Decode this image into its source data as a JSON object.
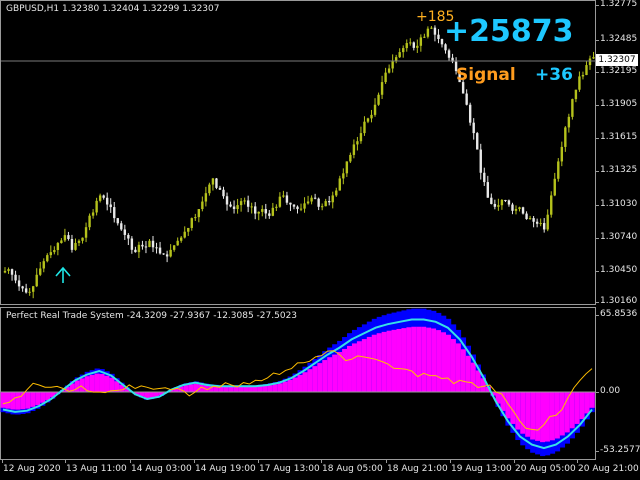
{
  "chart": {
    "symbol_label": "GBPUSD,H1  1.32380  1.32404  1.32299  1.32307",
    "current_price": "1.32307",
    "profit_big": "+25873",
    "profit_small": "+185",
    "signal_label": "Signal",
    "signal_value": "+36",
    "price_ticks": [
      "1.32775",
      "1.32485",
      "1.32195",
      "1.31905",
      "1.31615",
      "1.31325",
      "1.31030",
      "1.30740",
      "1.30450",
      "1.30160"
    ],
    "colors": {
      "bull_candle": "#b5c21c",
      "bear_candle": "#e8e8e8",
      "arrow": "#1ee6e6",
      "frame": "#9a9a9a"
    }
  },
  "indicator": {
    "label": "Perfect Real Trade System -24.3209 -27.9367 -12.3085 -27.5023",
    "ticks": [
      "65.8536",
      "0.00",
      "-53.2577"
    ],
    "colors": {
      "histogram_blue": "#0000ff",
      "histogram_magenta": "#ff00ff",
      "cyan_line": "#36e0e6",
      "yellow_line": "#ffbf00"
    }
  },
  "time_axis": [
    "12 Aug 2020",
    "13 Aug 11:00",
    "14 Aug 03:00",
    "14 Aug 19:00",
    "17 Aug 13:00",
    "18 Aug 05:00",
    "18 Aug 21:00",
    "19 Aug 13:00",
    "20 Aug 05:00",
    "20 Aug 21:00"
  ],
  "chart_data": [
    {
      "type": "candlestick",
      "title": "GBPUSD,H1",
      "ylim": [
        1.3016,
        1.3278
      ],
      "close": [
        1.3045,
        1.3035,
        1.3028,
        1.3025,
        1.304,
        1.3052,
        1.306,
        1.3068,
        1.3075,
        1.3062,
        1.307,
        1.3082,
        1.3095,
        1.311,
        1.3102,
        1.309,
        1.308,
        1.3072,
        1.306,
        1.3065,
        1.307,
        1.3064,
        1.3058,
        1.3062,
        1.307,
        1.3078,
        1.309,
        1.3098,
        1.3112,
        1.3125,
        1.3115,
        1.3102,
        1.3098,
        1.3105,
        1.31,
        1.3094,
        1.3098,
        1.3092,
        1.31,
        1.311,
        1.3102,
        1.3098,
        1.3103,
        1.3108,
        1.31,
        1.3105,
        1.311,
        1.3125,
        1.314,
        1.3155,
        1.3165,
        1.3178,
        1.319,
        1.321,
        1.3222,
        1.3232,
        1.324,
        1.3245,
        1.3242,
        1.325,
        1.3258,
        1.3248,
        1.3238,
        1.3228,
        1.321,
        1.319,
        1.3165,
        1.313,
        1.3108,
        1.31,
        1.3106,
        1.3102,
        1.3098,
        1.3094,
        1.309,
        1.3085,
        1.308,
        1.311,
        1.314,
        1.317,
        1.3195,
        1.3215,
        1.3225,
        1.3232
      ]
    },
    {
      "type": "line",
      "title": "Perfect Real Trade System",
      "ylim": [
        -53.2577,
        65.8536
      ],
      "series": [
        {
          "values": [
            -15,
            -17,
            -16,
            -12,
            -6,
            2,
            10,
            15,
            18,
            14,
            6,
            -2,
            -6,
            -4,
            2,
            6,
            8,
            6,
            5,
            5,
            5,
            5,
            6,
            8,
            12,
            18,
            25,
            32,
            38,
            45,
            50,
            55,
            58,
            60,
            62,
            62,
            60,
            55,
            45,
            30,
            12,
            -8,
            -25,
            -38,
            -45,
            -48,
            -45,
            -38,
            -28,
            -15
          ]
        },
        {
          "values": [
            -10,
            -5,
            2,
            6,
            4,
            3,
            2,
            1,
            0,
            1,
            2,
            3,
            4,
            3,
            2,
            1,
            0,
            2,
            4,
            6,
            8,
            10,
            12,
            15,
            20,
            25,
            30,
            35,
            32,
            28,
            30,
            28,
            24,
            20,
            18,
            16,
            14,
            12,
            10,
            8,
            5,
            0,
            -10,
            -25,
            -32,
            -28,
            -20,
            -5,
            10,
            20
          ]
        }
      ]
    }
  ]
}
